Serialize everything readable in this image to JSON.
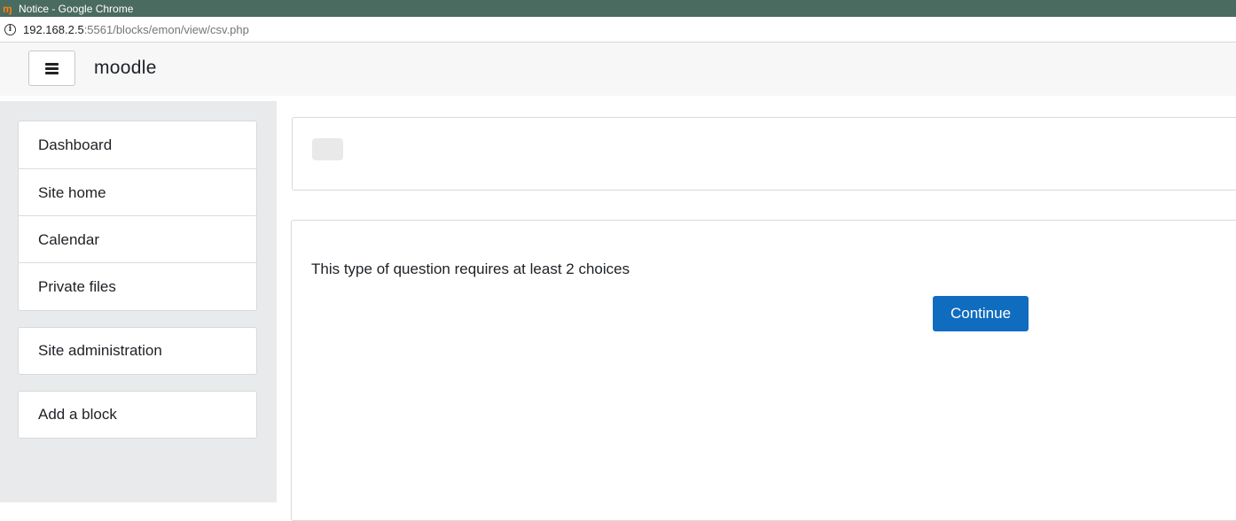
{
  "window": {
    "title": "Notice - Google Chrome",
    "favicon_icon": "moodle-favicon-icon"
  },
  "address_bar": {
    "host": "192.168.2.5",
    "path": ":5561/blocks/emon/view/csv.php"
  },
  "navbar": {
    "brand": "moodle",
    "menu_icon": "hamburger-icon"
  },
  "sidebar": {
    "primary_items": [
      {
        "label": "Dashboard"
      },
      {
        "label": "Site home"
      },
      {
        "label": "Calendar"
      },
      {
        "label": "Private files"
      }
    ],
    "admin_item": {
      "label": "Site administration"
    },
    "block_item": {
      "label": "Add a block"
    }
  },
  "main": {
    "notice_message": "This type of question requires at least 2 choices",
    "continue_label": "Continue"
  },
  "colors": {
    "titlebar": "#4a6b5f",
    "primary_button": "#0f6cbf",
    "drawer_bg": "#e9eaeb"
  }
}
